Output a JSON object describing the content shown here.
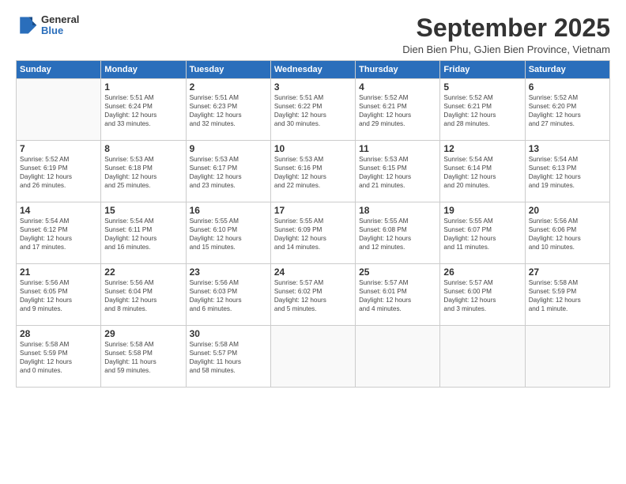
{
  "logo": {
    "general": "General",
    "blue": "Blue"
  },
  "title": "September 2025",
  "subtitle": "Dien Bien Phu, GJien Bien Province, Vietnam",
  "days": [
    "Sunday",
    "Monday",
    "Tuesday",
    "Wednesday",
    "Thursday",
    "Friday",
    "Saturday"
  ],
  "weeks": [
    [
      {
        "date": "",
        "info": ""
      },
      {
        "date": "1",
        "info": "Sunrise: 5:51 AM\nSunset: 6:24 PM\nDaylight: 12 hours\nand 33 minutes."
      },
      {
        "date": "2",
        "info": "Sunrise: 5:51 AM\nSunset: 6:23 PM\nDaylight: 12 hours\nand 32 minutes."
      },
      {
        "date": "3",
        "info": "Sunrise: 5:51 AM\nSunset: 6:22 PM\nDaylight: 12 hours\nand 30 minutes."
      },
      {
        "date": "4",
        "info": "Sunrise: 5:52 AM\nSunset: 6:21 PM\nDaylight: 12 hours\nand 29 minutes."
      },
      {
        "date": "5",
        "info": "Sunrise: 5:52 AM\nSunset: 6:21 PM\nDaylight: 12 hours\nand 28 minutes."
      },
      {
        "date": "6",
        "info": "Sunrise: 5:52 AM\nSunset: 6:20 PM\nDaylight: 12 hours\nand 27 minutes."
      }
    ],
    [
      {
        "date": "7",
        "info": "Sunrise: 5:52 AM\nSunset: 6:19 PM\nDaylight: 12 hours\nand 26 minutes."
      },
      {
        "date": "8",
        "info": "Sunrise: 5:53 AM\nSunset: 6:18 PM\nDaylight: 12 hours\nand 25 minutes."
      },
      {
        "date": "9",
        "info": "Sunrise: 5:53 AM\nSunset: 6:17 PM\nDaylight: 12 hours\nand 23 minutes."
      },
      {
        "date": "10",
        "info": "Sunrise: 5:53 AM\nSunset: 6:16 PM\nDaylight: 12 hours\nand 22 minutes."
      },
      {
        "date": "11",
        "info": "Sunrise: 5:53 AM\nSunset: 6:15 PM\nDaylight: 12 hours\nand 21 minutes."
      },
      {
        "date": "12",
        "info": "Sunrise: 5:54 AM\nSunset: 6:14 PM\nDaylight: 12 hours\nand 20 minutes."
      },
      {
        "date": "13",
        "info": "Sunrise: 5:54 AM\nSunset: 6:13 PM\nDaylight: 12 hours\nand 19 minutes."
      }
    ],
    [
      {
        "date": "14",
        "info": "Sunrise: 5:54 AM\nSunset: 6:12 PM\nDaylight: 12 hours\nand 17 minutes."
      },
      {
        "date": "15",
        "info": "Sunrise: 5:54 AM\nSunset: 6:11 PM\nDaylight: 12 hours\nand 16 minutes."
      },
      {
        "date": "16",
        "info": "Sunrise: 5:55 AM\nSunset: 6:10 PM\nDaylight: 12 hours\nand 15 minutes."
      },
      {
        "date": "17",
        "info": "Sunrise: 5:55 AM\nSunset: 6:09 PM\nDaylight: 12 hours\nand 14 minutes."
      },
      {
        "date": "18",
        "info": "Sunrise: 5:55 AM\nSunset: 6:08 PM\nDaylight: 12 hours\nand 12 minutes."
      },
      {
        "date": "19",
        "info": "Sunrise: 5:55 AM\nSunset: 6:07 PM\nDaylight: 12 hours\nand 11 minutes."
      },
      {
        "date": "20",
        "info": "Sunrise: 5:56 AM\nSunset: 6:06 PM\nDaylight: 12 hours\nand 10 minutes."
      }
    ],
    [
      {
        "date": "21",
        "info": "Sunrise: 5:56 AM\nSunset: 6:05 PM\nDaylight: 12 hours\nand 9 minutes."
      },
      {
        "date": "22",
        "info": "Sunrise: 5:56 AM\nSunset: 6:04 PM\nDaylight: 12 hours\nand 8 minutes."
      },
      {
        "date": "23",
        "info": "Sunrise: 5:56 AM\nSunset: 6:03 PM\nDaylight: 12 hours\nand 6 minutes."
      },
      {
        "date": "24",
        "info": "Sunrise: 5:57 AM\nSunset: 6:02 PM\nDaylight: 12 hours\nand 5 minutes."
      },
      {
        "date": "25",
        "info": "Sunrise: 5:57 AM\nSunset: 6:01 PM\nDaylight: 12 hours\nand 4 minutes."
      },
      {
        "date": "26",
        "info": "Sunrise: 5:57 AM\nSunset: 6:00 PM\nDaylight: 12 hours\nand 3 minutes."
      },
      {
        "date": "27",
        "info": "Sunrise: 5:58 AM\nSunset: 5:59 PM\nDaylight: 12 hours\nand 1 minute."
      }
    ],
    [
      {
        "date": "28",
        "info": "Sunrise: 5:58 AM\nSunset: 5:59 PM\nDaylight: 12 hours\nand 0 minutes."
      },
      {
        "date": "29",
        "info": "Sunrise: 5:58 AM\nSunset: 5:58 PM\nDaylight: 11 hours\nand 59 minutes."
      },
      {
        "date": "30",
        "info": "Sunrise: 5:58 AM\nSunset: 5:57 PM\nDaylight: 11 hours\nand 58 minutes."
      },
      {
        "date": "",
        "info": ""
      },
      {
        "date": "",
        "info": ""
      },
      {
        "date": "",
        "info": ""
      },
      {
        "date": "",
        "info": ""
      }
    ]
  ]
}
